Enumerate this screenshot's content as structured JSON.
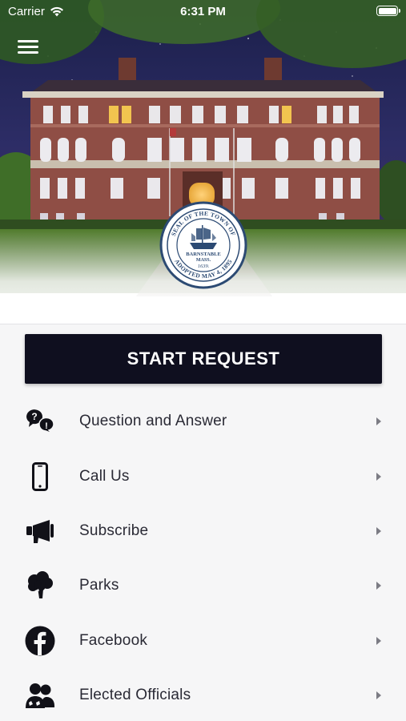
{
  "status_bar": {
    "carrier": "Carrier",
    "time": "6:31 PM"
  },
  "hero": {
    "seal": {
      "top_text": "SEAL OF THE TOWN OF",
      "center_line1": "BARNSTABLE",
      "center_line2": "MASS.",
      "center_line3": "1639.",
      "bottom_text": "ADOPTED MAY 4, 1895"
    }
  },
  "start_button": {
    "label": "START REQUEST"
  },
  "menu": {
    "items": [
      {
        "label": "Question and Answer",
        "icon": "question-answer-icon"
      },
      {
        "label": "Call Us",
        "icon": "phone-icon"
      },
      {
        "label": "Subscribe",
        "icon": "megaphone-icon"
      },
      {
        "label": "Parks",
        "icon": "tree-icon"
      },
      {
        "label": "Facebook",
        "icon": "facebook-icon"
      },
      {
        "label": "Elected Officials",
        "icon": "officials-icon"
      }
    ]
  },
  "colors": {
    "button_bg": "#0f0f1f",
    "text": "#2a2a35",
    "icon": "#111118",
    "seal_blue": "#2c4a73"
  }
}
